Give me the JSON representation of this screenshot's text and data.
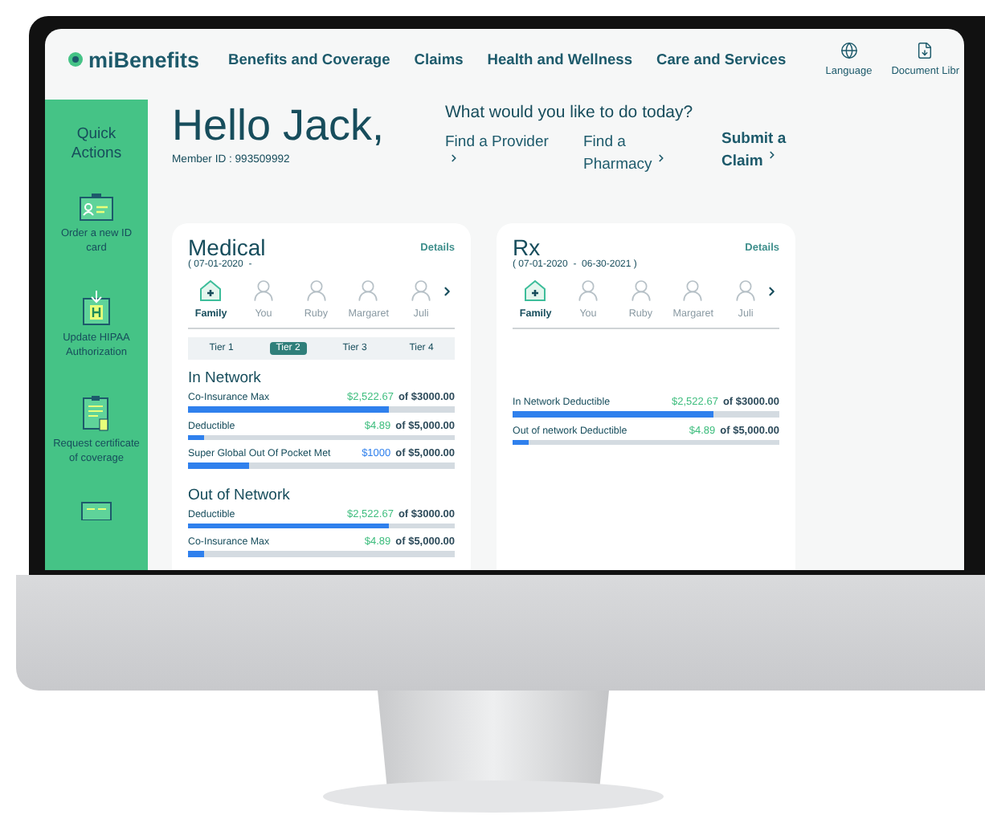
{
  "header": {
    "logo": "miBenefits",
    "nav": [
      {
        "label": "Benefits and Coverage"
      },
      {
        "label": "Claims"
      },
      {
        "label": "Health and Wellness"
      },
      {
        "label": "Care and Services"
      }
    ],
    "utilities": [
      {
        "kind": "language",
        "label": "Language"
      },
      {
        "kind": "document",
        "label": "Document Libr"
      }
    ]
  },
  "sidebar": {
    "title": "Quick Actions",
    "actions": [
      {
        "kind": "id-card",
        "label": "Order a new ID card"
      },
      {
        "kind": "hipaa",
        "label": "Update HIPAA Authorization"
      },
      {
        "kind": "certificate",
        "label": "Request certificate of coverage"
      },
      {
        "kind": "card"
      }
    ]
  },
  "greeting": {
    "title": "Hello Jack,",
    "member_id": "Member ID : 993509992"
  },
  "quick_links": {
    "prompt": "What would you like to do today?",
    "links": [
      {
        "label": "Find a Provider",
        "bold": false
      },
      {
        "label": "Find a Pharmacy",
        "bold": false
      },
      {
        "label": "Submit a Claim",
        "bold": true
      }
    ]
  },
  "cards": [
    {
      "title": "Medical",
      "period": "( 07-01-2020  -",
      "details": "Details",
      "members": [
        {
          "name": "Family",
          "kind": "family",
          "selected": true
        },
        {
          "name": "You",
          "kind": "person",
          "selected": false
        },
        {
          "name": "Ruby",
          "kind": "person",
          "selected": false
        },
        {
          "name": "Margaret",
          "kind": "person",
          "selected": false
        },
        {
          "name": "Juli",
          "kind": "person",
          "selected": false
        }
      ],
      "tiers": [
        {
          "label": "Tier 1",
          "selected": false
        },
        {
          "label": "Tier 2",
          "selected": true
        },
        {
          "label": "Tier 3",
          "selected": false
        },
        {
          "label": "Tier 4",
          "selected": false
        }
      ],
      "sections": [
        {
          "heading": "In Network",
          "rows": [
            {
              "label": "Co-Insurance Max",
              "amount": "$2,522.67",
              "total": "of $3000.00",
              "color": "#3dbd7d",
              "level": 0.75
            },
            {
              "label": "Deductible",
              "amount": "$4.89",
              "total": "of $5,000.00",
              "color": "#3dbd7d",
              "level": 0.06
            },
            {
              "label": "Super Global Out Of Pocket Met",
              "amount": "$1000",
              "total": "of $5,000.00",
              "color": "#2f80ed",
              "level": 0.23
            }
          ]
        },
        {
          "heading": "Out of Network",
          "rows": [
            {
              "label": "Deductible",
              "amount": "$2,522.67",
              "total": "of $3000.00",
              "color": "#3dbd7d",
              "level": 0.75
            },
            {
              "label": "Co-Insurance Max",
              "amount": "$4.89",
              "total": "of $5,000.00",
              "color": "#3dbd7d",
              "level": 0.06
            }
          ]
        }
      ]
    },
    {
      "title": "Rx",
      "period": "( 07-01-2020  -  06-30-2021 )",
      "details": "Details",
      "members": [
        {
          "name": "Family",
          "kind": "family",
          "selected": true
        },
        {
          "name": "You",
          "kind": "person",
          "selected": false
        },
        {
          "name": "Ruby",
          "kind": "person",
          "selected": false
        },
        {
          "name": "Margaret",
          "kind": "person",
          "selected": false
        },
        {
          "name": "Juli",
          "kind": "person",
          "selected": false
        }
      ],
      "sections": [
        {
          "rows": [
            {
              "label": "In Network Deductible",
              "amount": "$2,522.67",
              "total": "of $3000.00",
              "color": "#3dbd7d",
              "level": 0.75
            },
            {
              "label": "Out of network Deductible",
              "amount": "$4.89",
              "total": "of $5,000.00",
              "color": "#3dbd7d",
              "level": 0.06
            }
          ]
        }
      ]
    }
  ]
}
